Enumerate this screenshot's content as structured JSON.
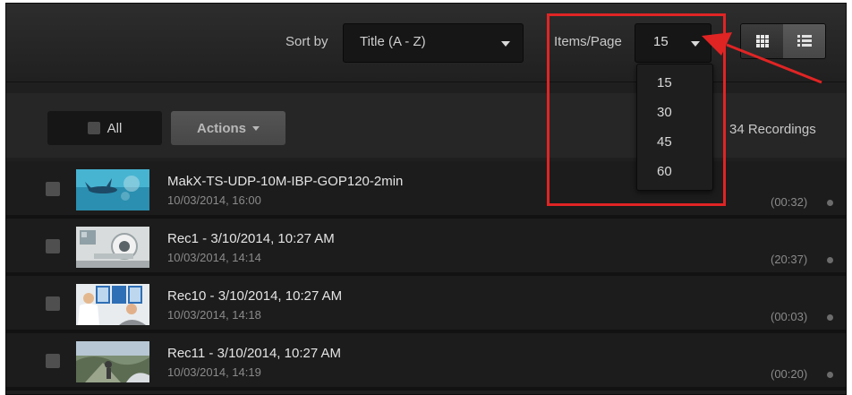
{
  "toolbar": {
    "sort_label": "Sort by",
    "sort_value": "Title (A - Z)",
    "items_label": "Items/Page",
    "items_value": "15",
    "view_grid_icon": "grid-view-icon",
    "view_list_icon": "list-view-icon"
  },
  "items_dropdown": {
    "options": [
      "15",
      "30",
      "45",
      "60"
    ]
  },
  "action_bar": {
    "all_label": "All",
    "actions_label": "Actions",
    "recordings_count": "34 Recordings"
  },
  "recordings": [
    {
      "title": "MakX-TS-UDP-10M-IBP-GOP120-2min",
      "date": "10/03/2014, 16:00",
      "duration": "(00:32)"
    },
    {
      "title": "Rec1 - 3/10/2014, 10:27 AM",
      "date": "10/03/2014, 14:14",
      "duration": "(20:37)"
    },
    {
      "title": "Rec10 - 3/10/2014, 10:27 AM",
      "date": "10/03/2014, 14:18",
      "duration": "(00:03)"
    },
    {
      "title": "Rec11 - 3/10/2014, 10:27 AM",
      "date": "10/03/2014, 14:19",
      "duration": "(00:20)"
    }
  ],
  "colors": {
    "highlight": "#e02424",
    "background": "#1f1f1f"
  }
}
